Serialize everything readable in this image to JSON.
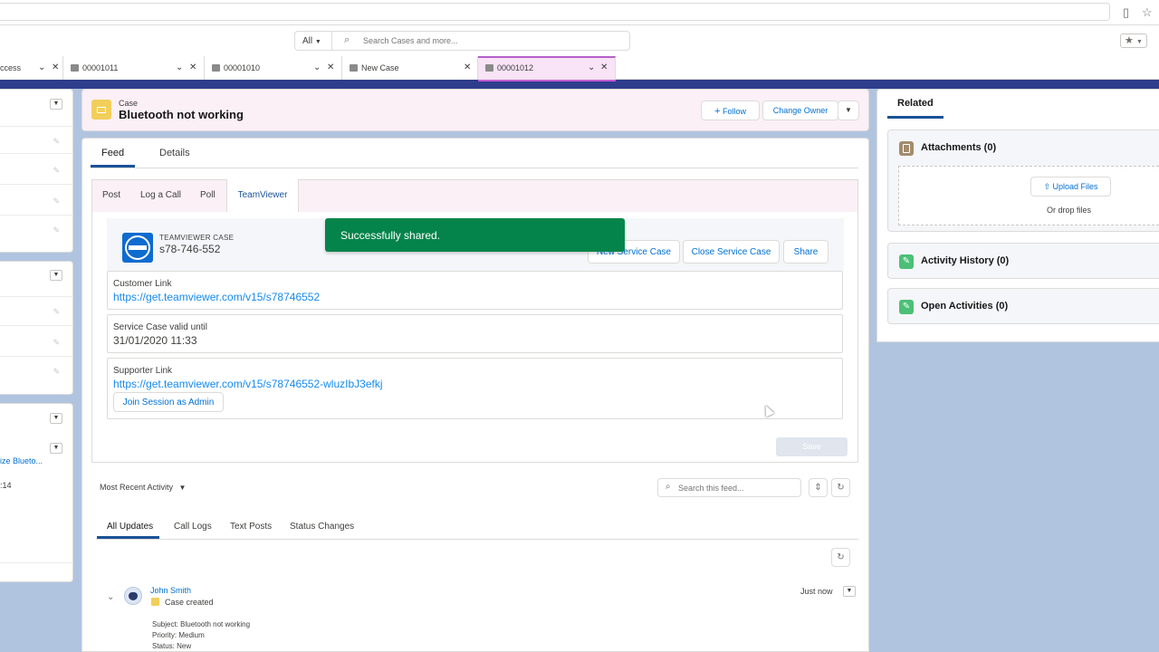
{
  "global": {
    "search_scope": "All",
    "search_placeholder": "Search Cases and more..."
  },
  "tabs": [
    {
      "label": "ccess"
    },
    {
      "label": "00001011"
    },
    {
      "label": "00001010"
    },
    {
      "label": "New Case"
    },
    {
      "label": "00001012"
    }
  ],
  "left_panel": {
    "link_text": "ize Blueto...",
    "time_text": ":14"
  },
  "case": {
    "type_label": "Case",
    "title": "Bluetooth not working",
    "follow_label": "Follow",
    "change_owner_label": "Change Owner"
  },
  "main_tabs": {
    "feed": "Feed",
    "details": "Details"
  },
  "publisher": {
    "tabs": [
      "Post",
      "Log a Call",
      "Poll",
      "TeamViewer"
    ]
  },
  "teamviewer": {
    "case_label": "TEAMVIEWER CASE",
    "case_id": "s78-746-552",
    "new_case_label": "New Service Case",
    "close_case_label": "Close Service Case",
    "share_label": "Share",
    "customer_link_label": "Customer Link",
    "customer_link": "https://get.teamviewer.com/v15/s78746552",
    "valid_until_label": "Service Case valid until",
    "valid_until": "31/01/2020 11:33",
    "supporter_link_label": "Supporter Link",
    "supporter_link": "https://get.teamviewer.com/v15/s78746552-wluzIbJ3efkj",
    "join_label": "Join Session as Admin",
    "save_label": "Save",
    "toast": "Successfully shared."
  },
  "feed": {
    "sort_label": "Most Recent Activity",
    "search_placeholder": "Search this feed...",
    "filter_tabs": [
      "All Updates",
      "Call Logs",
      "Text Posts",
      "Status Changes"
    ],
    "post": {
      "author": "John Smith",
      "action": "Case created",
      "time": "Just now",
      "lines": [
        "Subject: Bluetooth not working",
        "Priority: Medium",
        "Status: New"
      ]
    }
  },
  "related": {
    "tab_label": "Related",
    "attachments_title": "Attachments (0)",
    "upload_label": "Upload Files",
    "drop_text": "Or drop files",
    "activity_history_title": "Activity History (0)",
    "open_activities_title": "Open Activities (0)",
    "colors": {
      "attachments": "#a38b6d",
      "activity": "#4bc076"
    }
  }
}
